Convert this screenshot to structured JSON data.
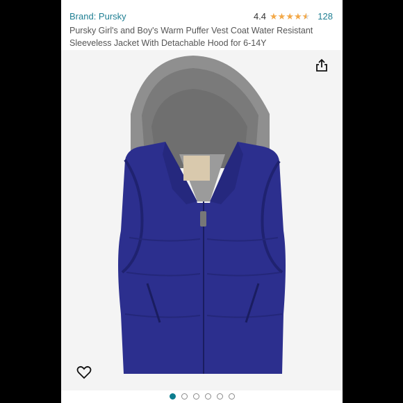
{
  "product": {
    "brand": "Brand: Pursky",
    "rating_value": "4.4",
    "rating_stars": 4.4,
    "rating_count": "128",
    "title": "Pursky Girl's and Boy's Warm Puffer Vest Coat Water Resistant Sleeveless Jacket With Detachable Hood for 6-14Y"
  },
  "gallery": {
    "image_subject": "navy puffer vest with grey hood",
    "active_index": 0,
    "total": 6
  },
  "icons": {
    "share": "share-icon",
    "wishlist": "heart-icon",
    "star": "star-icon"
  },
  "colors": {
    "link": "#1f7f93",
    "star": "#f3a847",
    "vest": "#2c2f8e",
    "hood": "#8f8f8f",
    "active_dot": "#0c7d8f"
  }
}
